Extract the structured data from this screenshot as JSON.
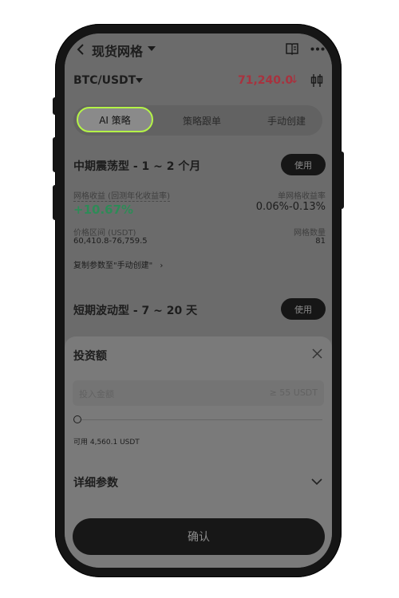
{
  "header": {
    "title": "现货网格"
  },
  "pair": {
    "symbol": "BTC/USDT",
    "price": "71,240.0",
    "price_arrow": "↓",
    "price_color": "#a8323e"
  },
  "tabs": [
    {
      "label": "AI 策略",
      "active": true
    },
    {
      "label": "策略跟单",
      "active": false
    },
    {
      "label": "手动创建",
      "active": false
    }
  ],
  "strategies": [
    {
      "title": "中期震荡型 - 1 ~ 2 个月",
      "use_label": "使用",
      "yield_label": "网格收益 (回测年化收益率)",
      "yield_value": "+10.67%",
      "per_grid_label": "单网格收益率",
      "per_grid_value": "0.06%-0.13%",
      "range_label": "价格区间 (USDT)",
      "range_value": "60,410.8-76,759.5",
      "grid_count_label": "网格数量",
      "grid_count_value": "81",
      "copy_link": "复制参数至\"手动创建\""
    },
    {
      "title": "短期波动型 - 7 ~ 20 天",
      "use_label": "使用"
    }
  ],
  "sheet": {
    "title": "投资额",
    "input_placeholder": "投入金额",
    "input_hint": "≥ 55 USDT",
    "slider_percent": 0,
    "available": "可用 4,560.1 USDT",
    "details_label": "详细参数",
    "confirm_label": "确认"
  },
  "colors": {
    "accent": "#b4f447",
    "positive": "#2e8b57"
  }
}
